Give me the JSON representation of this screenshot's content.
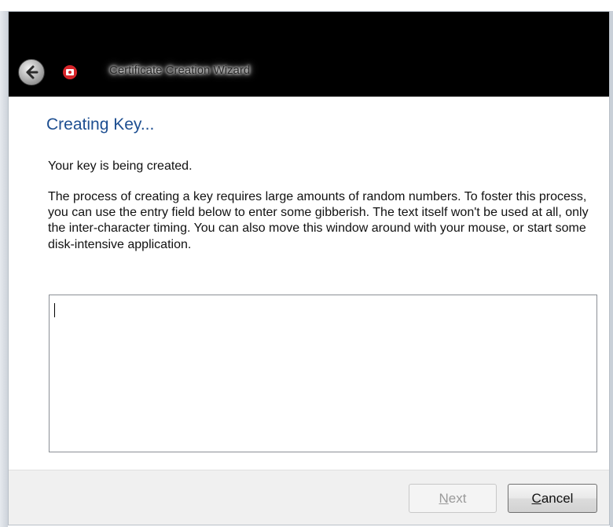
{
  "window": {
    "title": "Certificate Creation Wizard"
  },
  "page": {
    "title": "Creating Key...",
    "intro": "Your key is being created.",
    "description": "The process of creating a key requires large amounts of random numbers. To foster this process, you can use the entry field below to enter some gibberish. The text itself won't be used at all, only the inter-character timing. You can also move this window around with your mouse, or start some disk-intensive application."
  },
  "entropy_field": {
    "value": ""
  },
  "buttons": {
    "next": {
      "mnemonic": "N",
      "rest": "ext",
      "enabled": false
    },
    "cancel": {
      "mnemonic": "C",
      "rest": "ancel",
      "enabled": true
    }
  },
  "icons": {
    "back": "back-arrow-icon",
    "app": "certificate-app-icon"
  },
  "colors": {
    "title_bar": "#000000",
    "page_title": "#1e4f91",
    "footer": "#f0f0f0"
  }
}
